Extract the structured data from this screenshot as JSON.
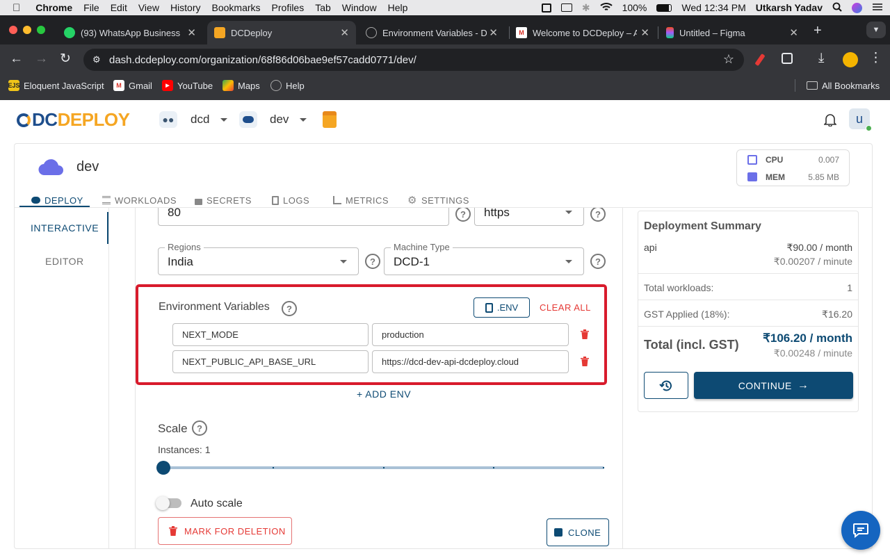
{
  "menubar": {
    "app": "Chrome",
    "items": [
      "File",
      "Edit",
      "View",
      "History",
      "Bookmarks",
      "Profiles",
      "Tab",
      "Window",
      "Help"
    ],
    "battery": "100%",
    "clock": "Wed 12:34 PM",
    "user": "Utkarsh Yadav"
  },
  "tabs": [
    {
      "title": "(93) WhatsApp Business",
      "badge": "93"
    },
    {
      "title": "DCDeploy"
    },
    {
      "title": "Environment Variables - D"
    },
    {
      "title": "Welcome to DCDeploy – A"
    },
    {
      "title": "Untitled – Figma"
    }
  ],
  "url": "dash.dcdeploy.com/organization/68f86d06bae9ef57cadd0771/dev/",
  "bookmarks": [
    "Eloquent JavaScript",
    "Gmail",
    "YouTube",
    "Maps",
    "Help"
  ],
  "all_bookmarks": "All Bookmarks",
  "app": {
    "logo_dc": "DC",
    "logo_deploy": "DEPLOY",
    "org": "dcd",
    "env": "dev",
    "avatar": "u"
  },
  "project": {
    "name": "dev",
    "cpu_label": "CPU",
    "cpu_value": "0.007",
    "mem_label": "MEM",
    "mem_value": "5.85 MB"
  },
  "nav_tabs": [
    "DEPLOY",
    "WORKLOADS",
    "SECRETS",
    "LOGS",
    "METRICS",
    "SETTINGS"
  ],
  "mode_tabs": [
    "INTERACTIVE",
    "EDITOR"
  ],
  "form": {
    "port_value": "80",
    "protocol_value": "https",
    "regions_label": "Regions",
    "regions_value": "India",
    "machine_label": "Machine Type",
    "machine_value": "DCD-1",
    "env_title": "Environment Variables",
    "env_button": ".ENV",
    "clear_all": "CLEAR ALL",
    "env_vars": [
      {
        "key": "NEXT_MODE",
        "value": "production"
      },
      {
        "key": "NEXT_PUBLIC_API_BASE_URL",
        "value": "https://dcd-dev-api-dcdeploy.cloud"
      }
    ],
    "add_env": "+ ADD ENV",
    "scale_title": "Scale",
    "instances": "Instances: 1",
    "instances_value": 1,
    "autoscale": "Auto scale",
    "mark_deletion": "MARK FOR DELETION",
    "clone": "CLONE"
  },
  "summary": {
    "title": "Deployment Summary",
    "item_name": "api",
    "item_month": "₹90.00 / month",
    "item_minute": "₹0.00207 / minute",
    "workloads_label": "Total workloads:",
    "workloads_value": "1",
    "gst_label": "GST Applied (18%):",
    "gst_value": "₹16.20",
    "total_label": "Total (incl. GST)",
    "total_month": "₹106.20 / month",
    "total_minute": "₹0.00248 / minute",
    "continue": "CONTINUE"
  },
  "colors": {
    "primary": "#0d4a73",
    "danger": "#e53935",
    "brand_orange": "#f5a623"
  }
}
